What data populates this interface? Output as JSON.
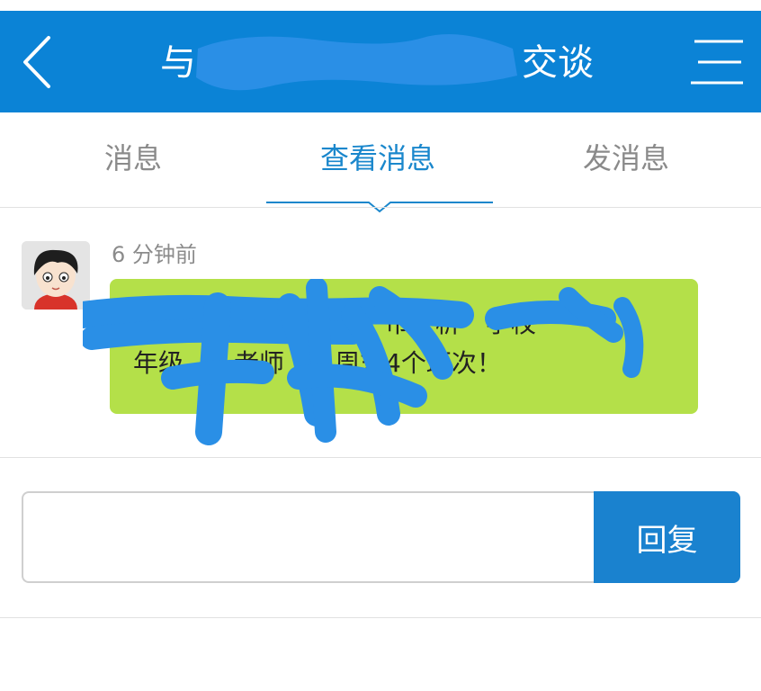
{
  "header": {
    "title_prefix": "与",
    "title_suffix": "交谈",
    "back_icon": "chevron-left-icon",
    "menu_icon": "hamburger-menu-icon"
  },
  "tabs": [
    {
      "label": "消息",
      "active": false
    },
    {
      "label": "查看消息",
      "active": true
    },
    {
      "label": "发消息",
      "active": false
    }
  ],
  "message": {
    "time": "6 分钟前",
    "line1": "　　　　　　　潼　　市，析　学校",
    "line2": "年级　　老师　　周末4个班次！",
    "avatar_icon": "cartoon-boy-avatar"
  },
  "reply": {
    "value": "",
    "button_label": "回复"
  },
  "colors": {
    "header_bg": "#0b83d6",
    "active_tab": "#1a87cc",
    "bubble_bg": "#b4e049",
    "reply_button_bg": "#1a82cf",
    "redaction": "#2a8fe6"
  }
}
